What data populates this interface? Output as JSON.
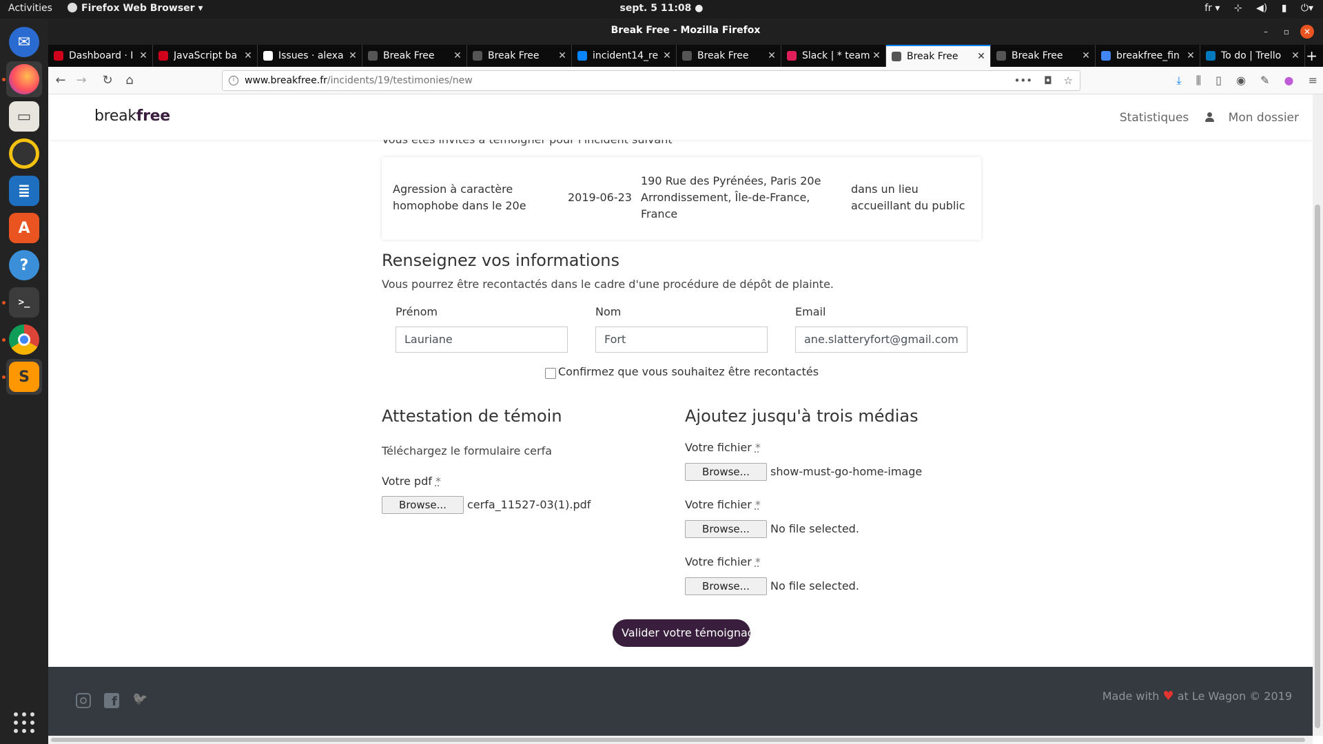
{
  "topbar": {
    "activities": "Activities",
    "app_menu": "Firefox Web Browser ▾",
    "clock": "sept. 5  11:08 ●",
    "lang": "fr ▾",
    "tray_icons": [
      "network-icon",
      "volume-icon",
      "battery-icon",
      "power-icon"
    ]
  },
  "dock": {
    "items": [
      "thunderbird-icon",
      "firefox-icon",
      "files-icon",
      "rhythmbox-icon",
      "writer-icon",
      "software-icon",
      "help-icon",
      "terminal-icon",
      "chrome-icon",
      "sublime-icon"
    ]
  },
  "window": {
    "title": "Break Free - Mozilla Firefox"
  },
  "tabs": [
    {
      "label": "Dashboard · I",
      "color": "#d0021b"
    },
    {
      "label": "JavaScript ba",
      "color": "#d0021b"
    },
    {
      "label": "Issues · alexa",
      "color": "#ffffff"
    },
    {
      "label": "Break Free",
      "color": "#555555"
    },
    {
      "label": "Break Free",
      "color": "#555555"
    },
    {
      "label": "incident14_re",
      "color": "#0a84ff"
    },
    {
      "label": "Break Free",
      "color": "#555555"
    },
    {
      "label": "Slack | * team",
      "color": "#e01e5a"
    },
    {
      "label": "Break Free",
      "color": "#555555",
      "active": true
    },
    {
      "label": "Break Free",
      "color": "#555555"
    },
    {
      "label": "breakfree_fin",
      "color": "#4285f4"
    },
    {
      "label": "To do | Trello",
      "color": "#0079bf"
    }
  ],
  "url": {
    "host": "www.breakfree.fr",
    "path": "/incidents/19/testimonies/new"
  },
  "site": {
    "logo_light": "break",
    "logo_bold": "free",
    "nav_stats": "Statistiques",
    "nav_folder": "Mon dossier"
  },
  "intro": "Vous êtes invités à témoigner pour l'incident suivant",
  "incident": {
    "title": "Agression à caractère homophobe dans le 20e",
    "date": "2019-06-23",
    "address": "190 Rue des Pyrénées, Paris 20e Arrondissement, Île-de-France, France",
    "place": "dans un lieu accueillant du public"
  },
  "info_section": {
    "heading": "Renseignez vos informations",
    "subtext": "Vous pourrez être recontactés dans le cadre d'une procédure de dépôt de plainte.",
    "firstname_label": "Prénom",
    "firstname_value": "Lauriane",
    "lastname_label": "Nom",
    "lastname_value": "Fort",
    "email_label": "Email",
    "email_value": "ane.slatteryfort@gmail.com",
    "confirm_label": "Confirmez que vous souhaitez être recontactés"
  },
  "attestation": {
    "heading": "Attestation de témoin",
    "download_text": "Téléchargez le formulaire cerfa",
    "pdf_label": "Votre pdf",
    "required_mark": "*",
    "browse": "Browse...",
    "pdf_file": "cerfa_11527-03(1).pdf"
  },
  "media": {
    "heading": "Ajoutez jusqu'à trois médias",
    "file_label": "Votre fichier",
    "required_mark": "*",
    "browse": "Browse...",
    "files": [
      "show-must-go-home-image",
      "No file selected.",
      "No file selected."
    ]
  },
  "submit_label": "Valider votre témoignage",
  "footer": {
    "made_with": "Made with",
    "at": "at Le Wagon © 2019"
  }
}
